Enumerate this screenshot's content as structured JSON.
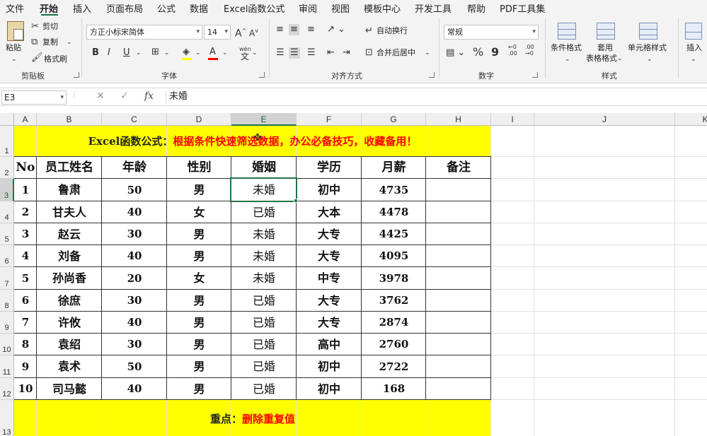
{
  "menu": {
    "tabs": [
      "文件",
      "开始",
      "插入",
      "页面布局",
      "公式",
      "数据",
      "Excel函数公式",
      "审阅",
      "视图",
      "模板中心",
      "开发工具",
      "帮助",
      "PDF工具集"
    ]
  },
  "ribbon": {
    "clipboard": {
      "paste": "粘贴",
      "cut": "剪切",
      "copy": "复制",
      "format_painter": "格式刷",
      "label": "剪贴板"
    },
    "font": {
      "name": "方正小标宋简体",
      "size": "14",
      "grow": "A",
      "shrink": "A",
      "bold": "B",
      "italic": "I",
      "underline": "U",
      "phonetic": "wén",
      "label": "字体"
    },
    "alignment": {
      "wrap": "自动换行",
      "merge": "合并后居中",
      "label": "对齐方式"
    },
    "number": {
      "format": "常规",
      "percent": "%",
      "comma": "9",
      "inc_decimal": "←0 .00",
      "dec_decimal": ".00 →0",
      "label": "数字"
    },
    "styles": {
      "conditional": "条件格式",
      "table_line1": "套用",
      "table_line2": "表格格式",
      "cell_styles": "单元格样式",
      "label": "样式"
    },
    "cells": {
      "insert": "插入"
    }
  },
  "formula_bar": {
    "name_box": "E3",
    "fx": "fx",
    "cancel": "✕",
    "confirm": "✓",
    "content": "未婚"
  },
  "columns": [
    "A",
    "B",
    "C",
    "D",
    "E",
    "F",
    "G",
    "H",
    "I",
    "J",
    "K"
  ],
  "rows": [
    "1",
    "2",
    "3",
    "4",
    "5",
    "6",
    "7",
    "8",
    "9",
    "10",
    "11",
    "12",
    "13"
  ],
  "sheet": {
    "title_prefix": "Excel函数公式：",
    "title_text": "根据条件快速筛选数据，办公必备技巧，收藏备用！",
    "headers": [
      "No",
      "员工姓名",
      "年龄",
      "性别",
      "婚姻",
      "学历",
      "月薪",
      "备注"
    ],
    "data": [
      [
        "1",
        "鲁肃",
        "50",
        "男",
        "未婚",
        "初中",
        "4735",
        ""
      ],
      [
        "2",
        "甘夫人",
        "40",
        "女",
        "已婚",
        "大本",
        "4478",
        ""
      ],
      [
        "3",
        "赵云",
        "30",
        "男",
        "未婚",
        "大专",
        "4425",
        ""
      ],
      [
        "4",
        "刘备",
        "40",
        "男",
        "未婚",
        "大专",
        "4095",
        ""
      ],
      [
        "5",
        "孙尚香",
        "20",
        "女",
        "未婚",
        "中专",
        "3978",
        ""
      ],
      [
        "6",
        "徐庶",
        "30",
        "男",
        "已婚",
        "大专",
        "3762",
        ""
      ],
      [
        "7",
        "许攸",
        "40",
        "男",
        "已婚",
        "大专",
        "2874",
        ""
      ],
      [
        "8",
        "袁绍",
        "30",
        "男",
        "已婚",
        "高中",
        "2760",
        ""
      ],
      [
        "9",
        "袁术",
        "50",
        "男",
        "已婚",
        "初中",
        "2722",
        ""
      ],
      [
        "10",
        "司马懿",
        "40",
        "男",
        "已婚",
        "初中",
        "168",
        ""
      ]
    ],
    "footer_prefix": "重点：",
    "footer_text": "删除重复值"
  },
  "colors": {
    "highlight": "#ffff00",
    "red_text": "#ff0000",
    "selection": "#217346"
  }
}
